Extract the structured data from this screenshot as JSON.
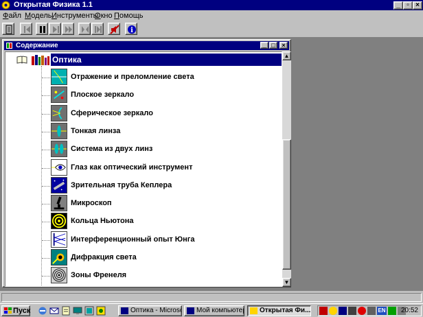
{
  "window": {
    "title": "Открытая Физика 1.1"
  },
  "menu": [
    {
      "pre": "",
      "key": "Ф",
      "post": "айл"
    },
    {
      "pre": "",
      "key": "М",
      "post": "одель"
    },
    {
      "pre": "",
      "key": "И",
      "post": "нструменты"
    },
    {
      "pre": "",
      "key": "О",
      "post": "кно"
    },
    {
      "pre": "",
      "key": "П",
      "post": "омощь"
    }
  ],
  "toolbar": {
    "buttons": [
      "exit-icon",
      "back-icon",
      "pause-icon",
      "step-forward-icon",
      "fast-forward-icon",
      "restart-icon",
      "step-end-icon",
      "sound-off-icon",
      "info-icon"
    ]
  },
  "contents": {
    "title": "Содержание",
    "root": "Оптика",
    "items": [
      {
        "label": "Отражение и преломление света",
        "icon": "reflection-refraction-icon"
      },
      {
        "label": "Плоское зеркало",
        "icon": "plane-mirror-icon"
      },
      {
        "label": "Сферическое зеркало",
        "icon": "spherical-mirror-icon"
      },
      {
        "label": "Тонкая линза",
        "icon": "thin-lens-icon"
      },
      {
        "label": "Система из двух линз",
        "icon": "two-lens-system-icon"
      },
      {
        "label": "Глаз как оптический инструмент",
        "icon": "eye-icon"
      },
      {
        "label": "Зрительная труба Кеплера",
        "icon": "telescope-icon"
      },
      {
        "label": "Микроскоп",
        "icon": "microscope-icon"
      },
      {
        "label": "Кольца Ньютона",
        "icon": "newton-rings-icon"
      },
      {
        "label": "Интерференционный опыт Юнга",
        "icon": "young-interference-icon"
      },
      {
        "label": "Дифракция света",
        "icon": "diffraction-icon"
      },
      {
        "label": "Зоны Френеля",
        "icon": "fresnel-zones-icon"
      }
    ]
  },
  "taskbar": {
    "start": "Пуск",
    "tasks": [
      {
        "label": "Оптика - Microso...",
        "active": false
      },
      {
        "label": "Мой компьютер",
        "active": false
      },
      {
        "label": "Открытая Фи...",
        "active": true
      }
    ],
    "tray_lang": "EN",
    "clock": "20:52"
  },
  "colors": {
    "titlebar": "#000080",
    "selection": "#000080",
    "face": "#c0c0c0",
    "desktop": "#808080"
  }
}
